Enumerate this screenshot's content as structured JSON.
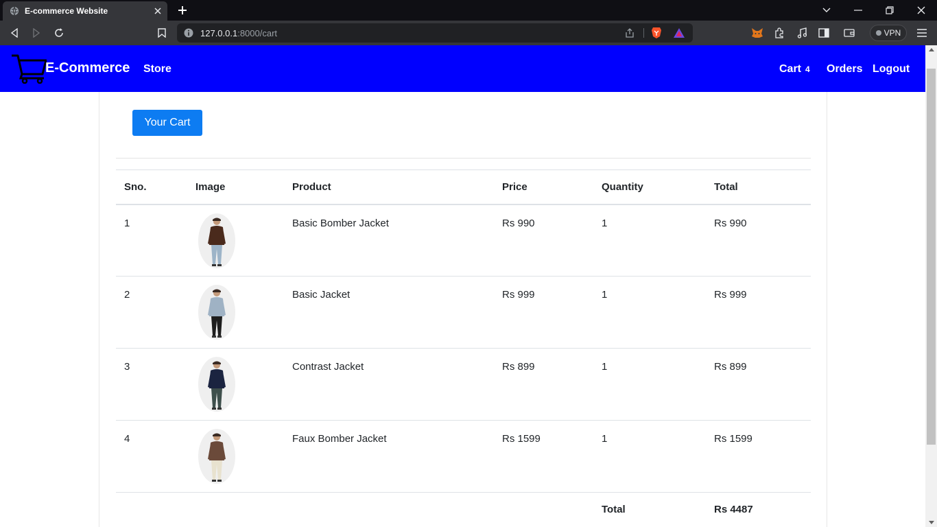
{
  "browser": {
    "tab_title": "E-commerce Website",
    "url_host": "127.0.0.1",
    "url_rest": ":8000/cart",
    "vpn_label": "VPN"
  },
  "navbar": {
    "brand": "E-Commerce",
    "store": "Store",
    "cart": "Cart",
    "cart_count": "4",
    "orders": "Orders",
    "logout": "Logout",
    "bg_color": "#0000ff"
  },
  "page": {
    "cart_button": "Your Cart"
  },
  "table": {
    "headers": [
      "Sno.",
      "Image",
      "Product",
      "Price",
      "Quantity",
      "Total"
    ],
    "rows": [
      {
        "sno": "1",
        "product": "Basic Bomber Jacket",
        "price": "Rs 990",
        "qty": "1",
        "total": "Rs 990",
        "jacket_color": "#4a2a1c",
        "pants_color": "#9db4c8"
      },
      {
        "sno": "2",
        "product": "Basic Jacket",
        "price": "Rs 999",
        "qty": "1",
        "total": "Rs 999",
        "jacket_color": "#9fb2c4",
        "pants_color": "#1d1d1d"
      },
      {
        "sno": "3",
        "product": "Contrast Jacket",
        "price": "Rs 899",
        "qty": "1",
        "total": "Rs 899",
        "jacket_color": "#1b2440",
        "pants_color": "#3e4f4c"
      },
      {
        "sno": "4",
        "product": "Faux Bomber Jacket",
        "price": "Rs 1599",
        "qty": "1",
        "total": "Rs 1599",
        "jacket_color": "#6b4a3a",
        "pants_color": "#e8e2cf"
      }
    ],
    "total_label": "Total",
    "grand_total": "Rs 4487"
  }
}
